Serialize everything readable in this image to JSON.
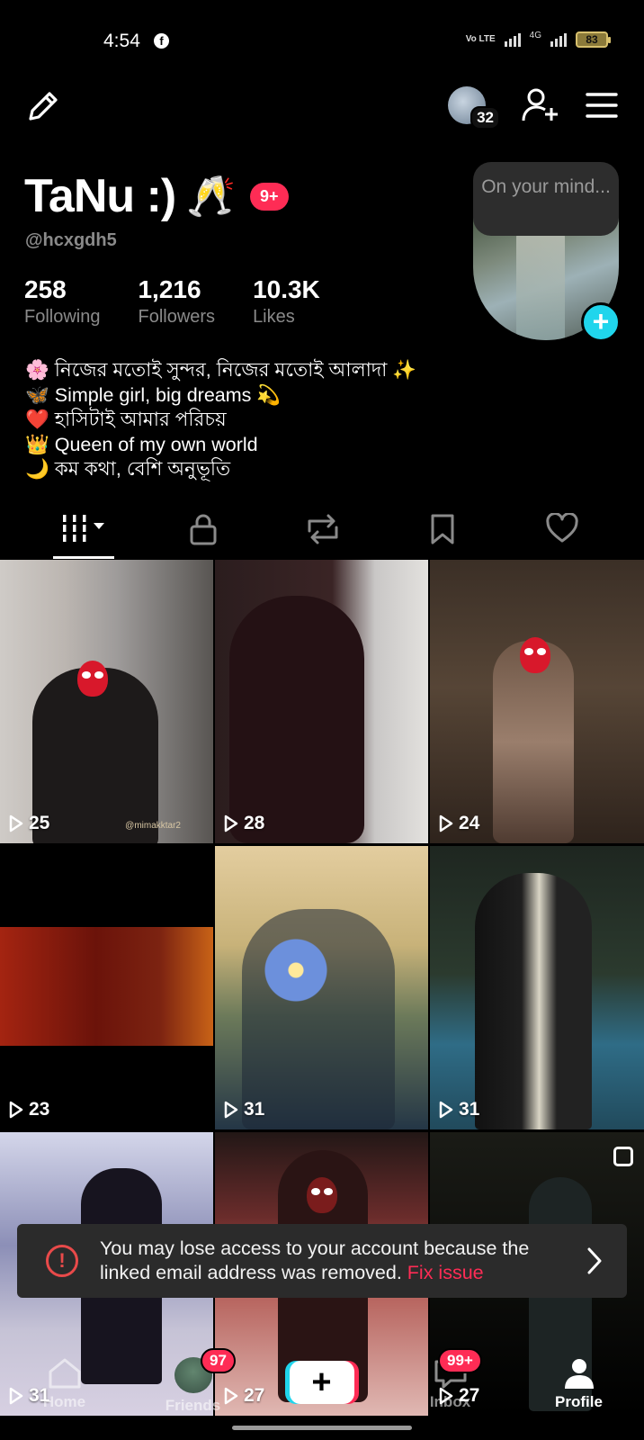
{
  "status_bar": {
    "time": "4:54",
    "network_tag": "Vo LTE",
    "network_type": "4G",
    "battery": "83"
  },
  "header": {
    "avatar_count": "32"
  },
  "profile": {
    "name": "TaNu :)",
    "name_emoji": "🥂",
    "notification_badge": "9+",
    "username": "@hcxgdh5",
    "thought_bubble": "On your mind...",
    "stats": [
      {
        "value": "258",
        "label": "Following"
      },
      {
        "value": "1,216",
        "label": "Followers"
      },
      {
        "value": "10.3K",
        "label": "Likes"
      }
    ],
    "bio": [
      "🌸 নিজের মতোই সুন্দর, নিজের মতোই আলাদা ✨",
      "🦋 Simple girl, big dreams 💫",
      "❤️ হাসিটাই আমার পরিচয়",
      "👑 Queen of my own world",
      "🌙 কম কথা, বেশি অনুভূতি"
    ]
  },
  "tabs": [
    "videos-tab",
    "private-tab",
    "reposts-tab",
    "favorites-tab",
    "liked-tab"
  ],
  "videos": [
    {
      "views": "25",
      "watermark": "@mimakktar2"
    },
    {
      "views": "28"
    },
    {
      "views": "24"
    },
    {
      "views": "23"
    },
    {
      "views": "31"
    },
    {
      "views": "31"
    },
    {
      "views": "31"
    },
    {
      "views": "27"
    },
    {
      "views": "27"
    }
  ],
  "warning": {
    "message": "You may lose access to your account because the linked email address was removed.",
    "action": "Fix issue"
  },
  "bottom_nav": {
    "home": "Home",
    "friends": "Friends",
    "friends_badge": "97",
    "inbox": "Inbox",
    "inbox_badge": "99+",
    "profile": "Profile"
  },
  "colors": {
    "accent_red": "#fe2c55",
    "accent_cyan": "#20d5ec",
    "background": "#000000",
    "secondary_text": "#8a8a8a"
  }
}
